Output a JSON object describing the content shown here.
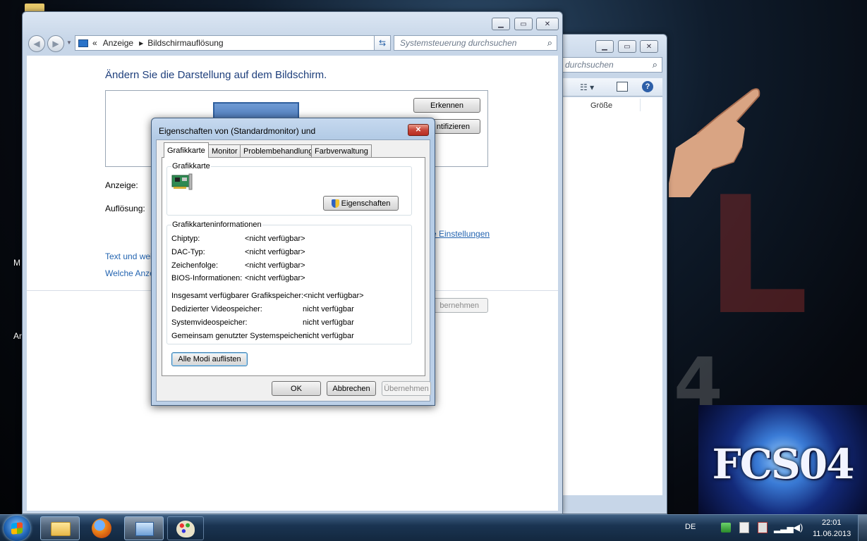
{
  "desktop": {
    "icon_labels": [
      "M",
      "Ar"
    ],
    "decor_letters": [
      "L",
      "4"
    ],
    "logo_text": "FCS04"
  },
  "control_panel": {
    "breadcrumb_overflow": "«",
    "breadcrumb": [
      "Anzeige",
      "Bildschirmauflösung"
    ],
    "search_placeholder": "Systemsteuerung durchsuchen",
    "heading": "Ändern Sie die Darstellung auf dem Bildschirm.",
    "detect_button": "Erkennen",
    "identify_button": "ntifizieren",
    "display_label": "Anzeige:",
    "resolution_label": "Auflösung:",
    "advanced_link": "e Einstellungen",
    "link_text_size": "Text und weit",
    "link_which_display": "Welche Anze",
    "apply_button": "bernehmen"
  },
  "explorer": {
    "search_placeholder": "durchsuchen",
    "column_size": "Größe"
  },
  "dialog": {
    "title": "Eigenschaften von (Standardmonitor) und",
    "tabs": [
      "Grafikkarte",
      "Monitor",
      "Problembehandlung",
      "Farbverwaltung"
    ],
    "adapter_group_title": "Grafikkarte",
    "properties_button": "Eigenschaften",
    "info_group_title": "Grafikkarteninformationen",
    "info_rows": [
      {
        "label": "Chiptyp:",
        "value": "<nicht verfügbar>"
      },
      {
        "label": "DAC-Typ:",
        "value": "<nicht verfügbar>"
      },
      {
        "label": "Zeichenfolge:",
        "value": "<nicht verfügbar>"
      },
      {
        "label": "BIOS-Informationen:",
        "value": "<nicht verfügbar>"
      }
    ],
    "memory_rows": [
      {
        "label": "Insgesamt verfügbarer Grafikspeicher:",
        "value": "<nicht verfügbar>"
      },
      {
        "label": "Dedizierter Videospeicher:",
        "value": "nicht verfügbar"
      },
      {
        "label": "Systemvideospeicher:",
        "value": "nicht verfügbar"
      },
      {
        "label": "Gemeinsam genutzter Systemspeicher:",
        "value": "nicht verfügbar"
      }
    ],
    "list_modes_button": "Alle Modi auflisten",
    "ok_button": "OK",
    "cancel_button": "Abbrechen",
    "apply_button": "Übernehmen"
  },
  "taskbar": {
    "language": "DE",
    "time": "22:01",
    "date": "11.06.2013"
  },
  "colors": {
    "link": "#2364b0",
    "heading": "#1e3f7c",
    "taskbar": "#1a3452"
  }
}
